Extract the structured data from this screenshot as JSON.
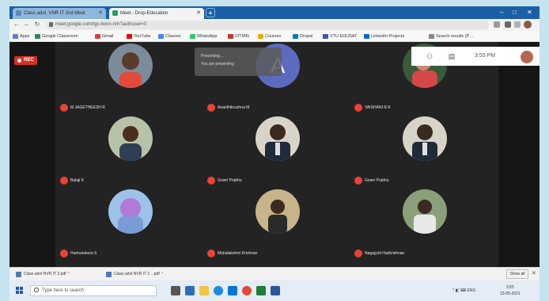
{
  "browser": {
    "tabs": [
      {
        "title": "Class advt. VNR IT 2nd Meet",
        "active": false
      },
      {
        "title": "Meet - Drop-Education",
        "active": true
      }
    ],
    "new_tab": "+",
    "window_controls": [
      "–",
      "□",
      "✕"
    ],
    "address": "meet.google.com/tgc-bxnn-nrh?authuser=0",
    "bookmarks": [
      "Apps",
      "Google Classroom",
      "Gmail",
      "YouTube",
      "Classes",
      "WhatsApp",
      "VITIAN",
      "Courses",
      "Drupal",
      "VTU EDUSAT",
      "LinkedIn Projects",
      "Search results (P…"
    ]
  },
  "meet": {
    "rec_label": "REC",
    "clock": "3:55 PM",
    "notification": {
      "line1": "Presenting…",
      "line2": "You are presenting"
    },
    "participants": [
      {
        "name": "M JAGETHEESH R",
        "avatar": "photo",
        "color": "#e24a3a"
      },
      {
        "name": "Ananthikrushna M",
        "avatar": "letter",
        "letter": "A"
      },
      {
        "name": "VAISHANI R K",
        "avatar": "photo",
        "color": "#d64848"
      },
      {
        "name": "Balaji K",
        "avatar": "photo",
        "color": "#7b8d6a"
      },
      {
        "name": "Gowri Prabhu",
        "avatar": "photo",
        "color": "#c9c9c9"
      },
      {
        "name": "Gowri Prabhu",
        "avatar": "photo",
        "color": "#c9c9c9"
      },
      {
        "name": "Harinandana S",
        "avatar": "photo",
        "color": "#7a9bd6"
      },
      {
        "name": "Mahalakshmi Krishnan",
        "avatar": "photo",
        "color": "#8a6a3a"
      },
      {
        "name": "Nagajyoti Harikrishnan",
        "avatar": "photo",
        "color": "#9aa88a"
      }
    ]
  },
  "downloads": {
    "items": [
      "Class advt NVR IT 2.pdf",
      "Class advt NVR IT 2 ...pdf"
    ],
    "show_all": "Show all"
  },
  "taskbar": {
    "search_placeholder": "Type here to search",
    "tray_text": "^ ◧ ⌨ ENG",
    "time": "3:55",
    "date": "13-05-2021"
  }
}
